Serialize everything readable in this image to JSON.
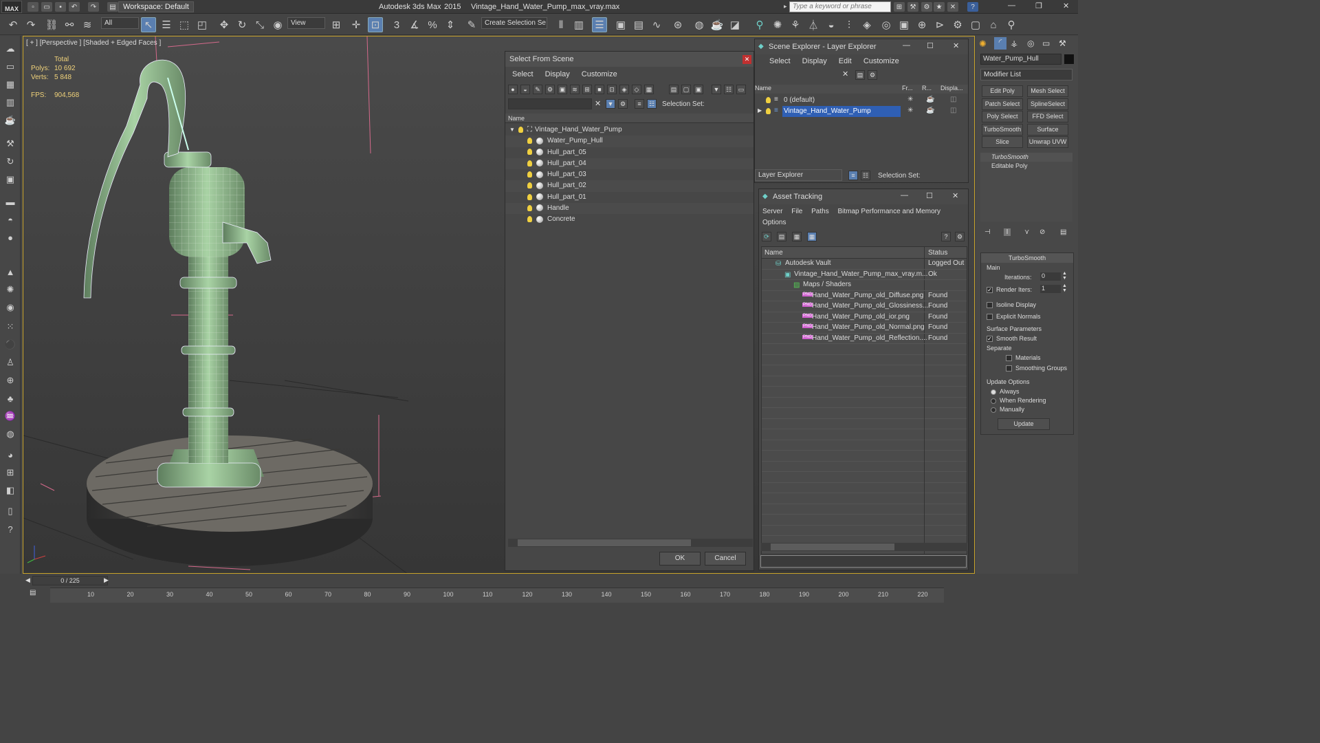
{
  "app": {
    "product": "Autodesk 3ds Max",
    "version": "2015",
    "file_title": "Vintage_Hand_Water_Pump_max_vray.max",
    "logo": "MAX",
    "workspace_label": "Workspace: Default",
    "keyword_placeholder": "Type a keyword or phrase"
  },
  "toolbar": {
    "filter_value": "All",
    "refcoord_value": "View",
    "selection_set_value": "Create Selection Se"
  },
  "viewport": {
    "label": "[ + ] [Perspective ] [Shaded + Edged Faces ]",
    "stats": {
      "total_label": "Total",
      "polys_label": "Polys:",
      "polys_value": "10 692",
      "verts_label": "Verts:",
      "verts_value": "5 848",
      "fps_label": "FPS:",
      "fps_value": "904,568"
    }
  },
  "select_from_scene": {
    "title": "Select From Scene",
    "menu": [
      "Select",
      "Display",
      "Customize"
    ],
    "selection_set_label": "Selection Set:",
    "column_name": "Name",
    "root": "Vintage_Hand_Water_Pump",
    "items": [
      "Water_Pump_Hull",
      "Hull_part_05",
      "Hull_part_04",
      "Hull_part_03",
      "Hull_part_02",
      "Hull_part_01",
      "Handle",
      "Concrete"
    ],
    "ok_label": "OK",
    "cancel_label": "Cancel"
  },
  "scene_explorer": {
    "title": "Scene Explorer - Layer Explorer",
    "menu": [
      "Select",
      "Display",
      "Edit",
      "Customize"
    ],
    "columns": [
      "Name",
      "Fr...",
      "R...",
      "Displa..."
    ],
    "layers": [
      "0 (default)",
      "Vintage_Hand_Water_Pump"
    ],
    "footer_dropdown": "Layer Explorer",
    "selection_set_label": "Selection Set:"
  },
  "asset_tracking": {
    "title": "Asset Tracking",
    "menu": [
      "Server",
      "File",
      "Paths",
      "Bitmap Performance and Memory",
      "Options"
    ],
    "columns": [
      "Name",
      "Status"
    ],
    "rows": [
      {
        "name": "Autodesk Vault",
        "status": "Logged Out",
        "indent": 0
      },
      {
        "name": "Vintage_Hand_Water_Pump_max_vray.m...",
        "status": "Ok",
        "indent": 1
      },
      {
        "name": "Maps / Shaders",
        "status": "",
        "indent": 2
      },
      {
        "name": "Hand_Water_Pump_old_Diffuse.png",
        "status": "Found",
        "indent": 3
      },
      {
        "name": "Hand_Water_Pump_old_Glossiness....",
        "status": "Found",
        "indent": 3
      },
      {
        "name": "Hand_Water_Pump_old_ior.png",
        "status": "Found",
        "indent": 3
      },
      {
        "name": "Hand_Water_Pump_old_Normal.png",
        "status": "Found",
        "indent": 3
      },
      {
        "name": "Hand_Water_Pump_old_Reflection....",
        "status": "Found",
        "indent": 3
      }
    ]
  },
  "command_panel": {
    "object_name": "Water_Pump_Hull",
    "modifier_list_label": "Modifier List",
    "modifier_buttons": [
      "Edit Poly",
      "Mesh Select",
      "Patch Select",
      "SplineSelect",
      "Poly Select",
      "FFD Select",
      "TurboSmooth",
      "Surface Select",
      "Slice",
      "Unwrap UVW"
    ],
    "stack": [
      "TurboSmooth",
      "Editable Poly"
    ],
    "rollout_title": "TurboSmooth",
    "main_label": "Main",
    "iterations_label": "Iterations:",
    "iterations_value": "0",
    "render_iters_label": "Render Iters:",
    "render_iters_value": "1",
    "isoline_label": "Isoline Display",
    "explicit_normals_label": "Explicit Normals",
    "surface_params_label": "Surface Parameters",
    "smooth_result_label": "Smooth Result",
    "separate_label": "Separate",
    "materials_label": "Materials",
    "smoothing_groups_label": "Smoothing Groups",
    "update_options_label": "Update Options",
    "always_label": "Always",
    "when_rendering_label": "When Rendering",
    "manually_label": "Manually",
    "update_button": "Update"
  },
  "timeline": {
    "frame_counter": "0 / 225",
    "ticks": [
      "10",
      "20",
      "30",
      "40",
      "50",
      "60",
      "70",
      "80",
      "90",
      "100",
      "110",
      "120",
      "130",
      "140",
      "150",
      "160",
      "170",
      "180",
      "190",
      "200",
      "210",
      "220"
    ]
  },
  "colors": {
    "accent": "#5a7fb0",
    "selection": "#2f5fb4",
    "viewport_border": "#c9a42a",
    "wire_green": "#9cc79a"
  }
}
